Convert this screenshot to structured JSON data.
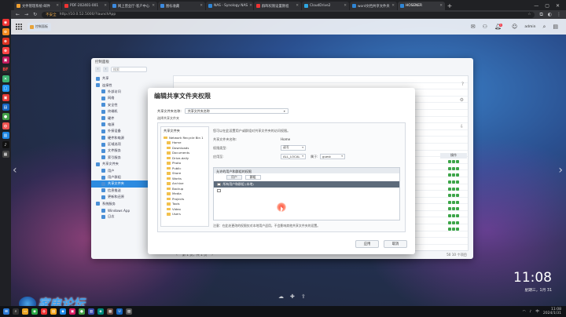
{
  "browser": {
    "tabs": [
      {
        "label": "文件管理系统-邮件",
        "color": "#f0a030",
        "active": false
      },
      {
        "label": "PDF-202401-001",
        "color": "#e33",
        "active": false
      },
      {
        "label": "网上营业厅-客户中心",
        "color": "#3d8be0",
        "active": false
      },
      {
        "label": "图标收藏",
        "color": "#3d8be0",
        "active": false
      },
      {
        "label": "NAS - Synology NAS",
        "color": "#2f86d6",
        "active": false
      },
      {
        "label": "群晖权限设置教程",
        "color": "#e33",
        "active": false
      },
      {
        "label": "CloudDrive2",
        "color": "#2fa6e0",
        "active": false
      },
      {
        "label": "word文档共享文件夹",
        "color": "#2f86d6",
        "active": false
      },
      {
        "label": "HOSENER",
        "color": "#2f86d6",
        "active": true
      }
    ],
    "address": {
      "security": "不安全",
      "url": "http://10.0.52.5000/?launchApp"
    }
  },
  "dsm": {
    "app_tab": "控制面板",
    "user": "admin",
    "badge": "5"
  },
  "control_panel": {
    "title": "控制面板",
    "search_placeholder": "搜索",
    "sidebar": [
      {
        "label": "共享",
        "sub": false,
        "sel": false
      },
      {
        "label": "连接性",
        "sub": false,
        "sel": false
      },
      {
        "label": "外部访问",
        "sub": true,
        "sel": false
      },
      {
        "label": "网络",
        "sub": true,
        "sel": false
      },
      {
        "label": "安全性",
        "sub": true,
        "sel": false
      },
      {
        "label": "终端机",
        "sub": true,
        "sel": false
      },
      {
        "label": "硬件",
        "sub": true,
        "sel": false
      },
      {
        "label": "电源",
        "sub": true,
        "sel": false
      },
      {
        "label": "外接设备",
        "sub": true,
        "sel": false
      },
      {
        "label": "硬件和电源",
        "sub": true,
        "sel": false
      },
      {
        "label": "区域选项",
        "sub": true,
        "sel": false
      },
      {
        "label": "文件服务",
        "sub": true,
        "sel": false
      },
      {
        "label": "索引服务",
        "sub": true,
        "sel": false
      },
      {
        "label": "共享文件夹",
        "sub": false,
        "sel": false
      },
      {
        "label": "用户",
        "sub": true,
        "sel": false
      },
      {
        "label": "用户群组",
        "sub": true,
        "sel": false
      },
      {
        "label": "共享文件夹",
        "sub": true,
        "sel": true
      },
      {
        "label": "信息推送",
        "sub": true,
        "sel": false
      },
      {
        "label": "更新和还原",
        "sub": true,
        "sel": false
      },
      {
        "label": "系统服务",
        "sub": false,
        "sel": false
      },
      {
        "label": "Windows App",
        "sub": true,
        "sel": false
      },
      {
        "label": "日志",
        "sub": true,
        "sel": false
      }
    ],
    "perm_column": "操作",
    "page_label": "第 1 页，共 1 页",
    "page_size": "50",
    "count": "10 个项目"
  },
  "modal": {
    "title": "编辑共享文件夹权限",
    "field_label": "共享文件夹名称:",
    "field_value": "共享文件夹名称",
    "sub_label": "选择共享文件夹",
    "tree_header": "共享文件夹",
    "tree": [
      {
        "label": "Network Recycle Bin 1",
        "top": true,
        "sel": false
      },
      {
        "label": "Home",
        "top": false,
        "sel": false
      },
      {
        "label": "Downloads",
        "top": false,
        "sel": false
      },
      {
        "label": "Documents",
        "top": false,
        "sel": false
      },
      {
        "label": "Drive-daily",
        "top": false,
        "sel": false
      },
      {
        "label": "Photo",
        "top": false,
        "sel": false
      },
      {
        "label": "Public",
        "top": false,
        "sel": false
      },
      {
        "label": "Share",
        "top": false,
        "sel": false
      },
      {
        "label": "Works",
        "top": false,
        "sel": false
      },
      {
        "label": "Archive",
        "top": false,
        "sel": false
      },
      {
        "label": "Backup",
        "top": false,
        "sel": false
      },
      {
        "label": "Media",
        "top": false,
        "sel": false
      },
      {
        "label": "Projects",
        "top": false,
        "sel": false
      },
      {
        "label": "Tools",
        "top": false,
        "sel": false
      },
      {
        "label": "Video",
        "top": false,
        "sel": false
      },
      {
        "label": "Users",
        "top": false,
        "sel": false
      }
    ],
    "info_line": "您可以在此设置用户或群组对共享文件夹的访问权限。",
    "folder_label": "共享文件夹名称:",
    "folder_value": "Home",
    "perm_type_label": "权限类型:",
    "perm_type_value": "读写",
    "apply_label": "应用至:",
    "apply_value": "ALL_LOCAL",
    "owner_label": "属于:",
    "owner_value": "guest",
    "perm_header": "允许的用户和群组的权限",
    "perm_tab_user": "用户",
    "perm_tab_group": "群组",
    "perm_row_dark": "所有用户和群组 (本地)",
    "perm_row_empty": "",
    "note": "注意：在此处更改的权限仅对本地用户适用，不会影响其他共享文件夹的设置。",
    "btn_ok": "应用",
    "btn_cancel": "取消"
  },
  "desktop": {
    "clock": "11:08",
    "date": "星期三，1月 31",
    "watermark": "家电论坛"
  },
  "taskbar": {
    "time": "11:08",
    "date": "2024/1/31"
  }
}
